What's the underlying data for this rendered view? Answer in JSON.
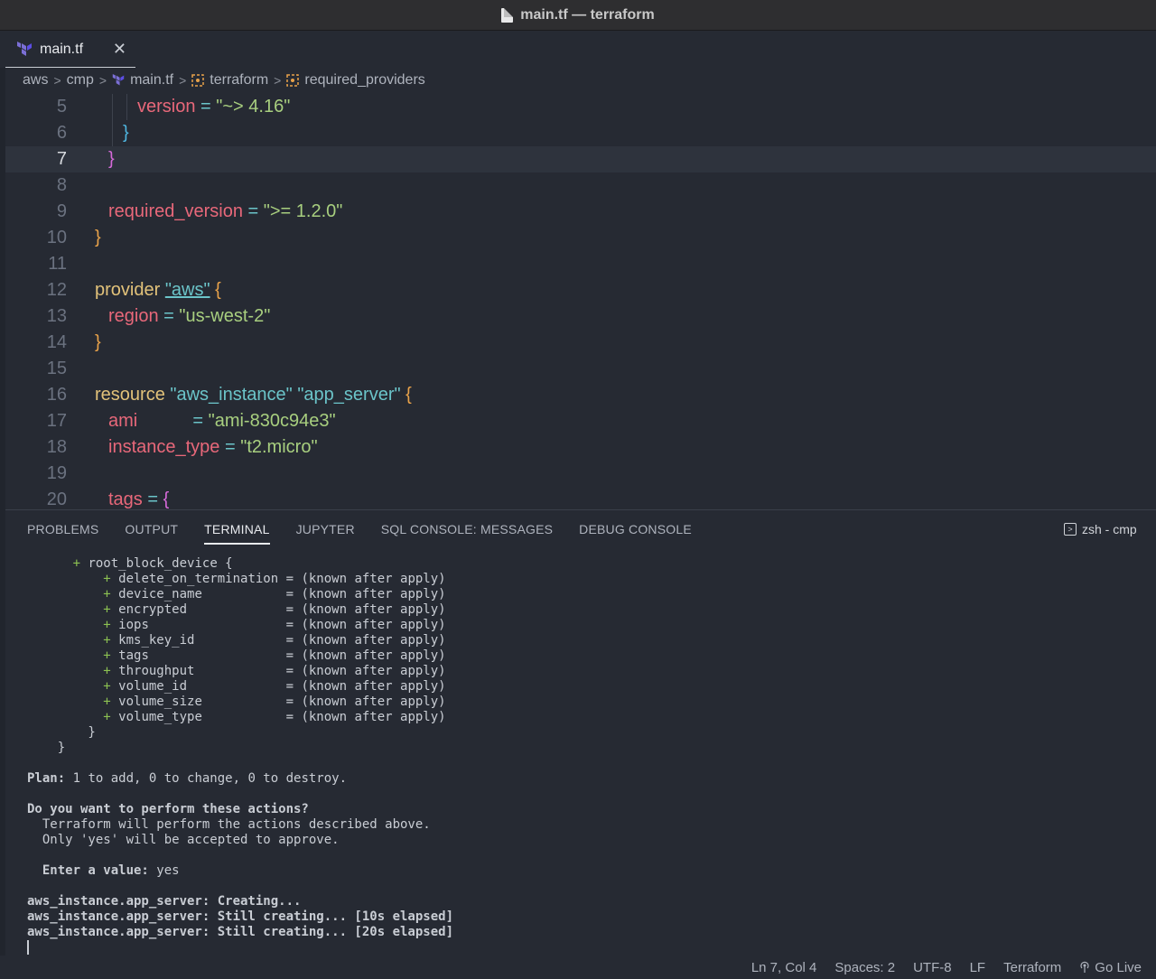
{
  "window": {
    "title": "main.tf — terraform"
  },
  "tab": {
    "label": "main.tf",
    "close_glyph": "✕"
  },
  "breadcrumb": [
    "aws",
    "cmp",
    "main.tf",
    "terraform",
    "required_providers"
  ],
  "editor": {
    "current_line": 7,
    "lines": [
      {
        "n": "5",
        "t": [
          [
            "a",
            "version"
          ],
          [
            "o",
            " = "
          ],
          [
            "s",
            "\"~> 4.16\""
          ]
        ]
      },
      {
        "n": "6",
        "t": [
          [
            "b3",
            "}"
          ]
        ]
      },
      {
        "n": "7",
        "t": [
          [
            "b2",
            "}"
          ]
        ]
      },
      {
        "n": "8",
        "t": []
      },
      {
        "n": "9",
        "t": [
          [
            "a",
            "required_version"
          ],
          [
            "o",
            " = "
          ],
          [
            "s",
            "\">= 1.2.0\""
          ]
        ]
      },
      {
        "n": "10",
        "t": [
          [
            "b1",
            "}"
          ]
        ]
      },
      {
        "n": "11",
        "t": []
      },
      {
        "n": "12",
        "t": [
          [
            "k",
            "provider "
          ],
          [
            "s2 ul",
            "\"aws\""
          ],
          [
            "b1",
            " {"
          ]
        ]
      },
      {
        "n": "13",
        "t": [
          [
            "a",
            "region"
          ],
          [
            "o",
            " = "
          ],
          [
            "s",
            "\"us-west-2\""
          ]
        ]
      },
      {
        "n": "14",
        "t": [
          [
            "b1",
            "}"
          ]
        ]
      },
      {
        "n": "15",
        "t": []
      },
      {
        "n": "16",
        "t": [
          [
            "k",
            "resource "
          ],
          [
            "s2",
            "\"aws_instance\""
          ],
          [
            "s2",
            " \"app_server\""
          ],
          [
            "b1",
            " {"
          ]
        ]
      },
      {
        "n": "17",
        "t": [
          [
            "a",
            "ami"
          ],
          [
            "o",
            "           = "
          ],
          [
            "s",
            "\"ami-830c94e3\""
          ]
        ]
      },
      {
        "n": "18",
        "t": [
          [
            "a",
            "instance_type"
          ],
          [
            "o",
            " = "
          ],
          [
            "s",
            "\"t2.micro\""
          ]
        ]
      },
      {
        "n": "19",
        "t": []
      },
      {
        "n": "20",
        "t": [
          [
            "a",
            "tags"
          ],
          [
            "o",
            " = "
          ],
          [
            "b2",
            "{"
          ]
        ]
      }
    ]
  },
  "panel": {
    "tabs": [
      "PROBLEMS",
      "OUTPUT",
      "TERMINAL",
      "JUPYTER",
      "SQL CONSOLE: MESSAGES",
      "DEBUG CONSOLE"
    ],
    "active_tab": "TERMINAL",
    "shell_label": "zsh - cmp"
  },
  "terminal": {
    "block_header": "root_block_device {",
    "attributes": [
      [
        "delete_on_termination",
        "(known after apply)"
      ],
      [
        "device_name",
        "(known after apply)"
      ],
      [
        "encrypted",
        "(known after apply)"
      ],
      [
        "iops",
        "(known after apply)"
      ],
      [
        "kms_key_id",
        "(known after apply)"
      ],
      [
        "tags",
        "(known after apply)"
      ],
      [
        "throughput",
        "(known after apply)"
      ],
      [
        "volume_id",
        "(known after apply)"
      ],
      [
        "volume_size",
        "(known after apply)"
      ],
      [
        "volume_type",
        "(known after apply)"
      ]
    ],
    "plan_label": "Plan:",
    "plan_text": " 1 to add, 0 to change, 0 to destroy.",
    "question": "Do you want to perform these actions?",
    "explain1": "  Terraform will perform the actions described above.",
    "explain2": "  Only 'yes' will be accepted to approve.",
    "enter_label": "  Enter a value:",
    "enter_value": " yes",
    "progress": [
      "aws_instance.app_server: Creating...",
      "aws_instance.app_server: Still creating... [10s elapsed]",
      "aws_instance.app_server: Still creating... [20s elapsed]"
    ]
  },
  "statusbar": {
    "position": "Ln 7, Col 4",
    "spaces": "Spaces: 2",
    "encoding": "UTF-8",
    "eol": "LF",
    "language": "Terraform",
    "golive": "Go Live"
  },
  "colors": {
    "keyword": "#e2c27a",
    "attribute": "#e8687a",
    "string": "#a8cf7f",
    "operator": "#6bc4c9",
    "terminal_plus": "#8cc152"
  }
}
